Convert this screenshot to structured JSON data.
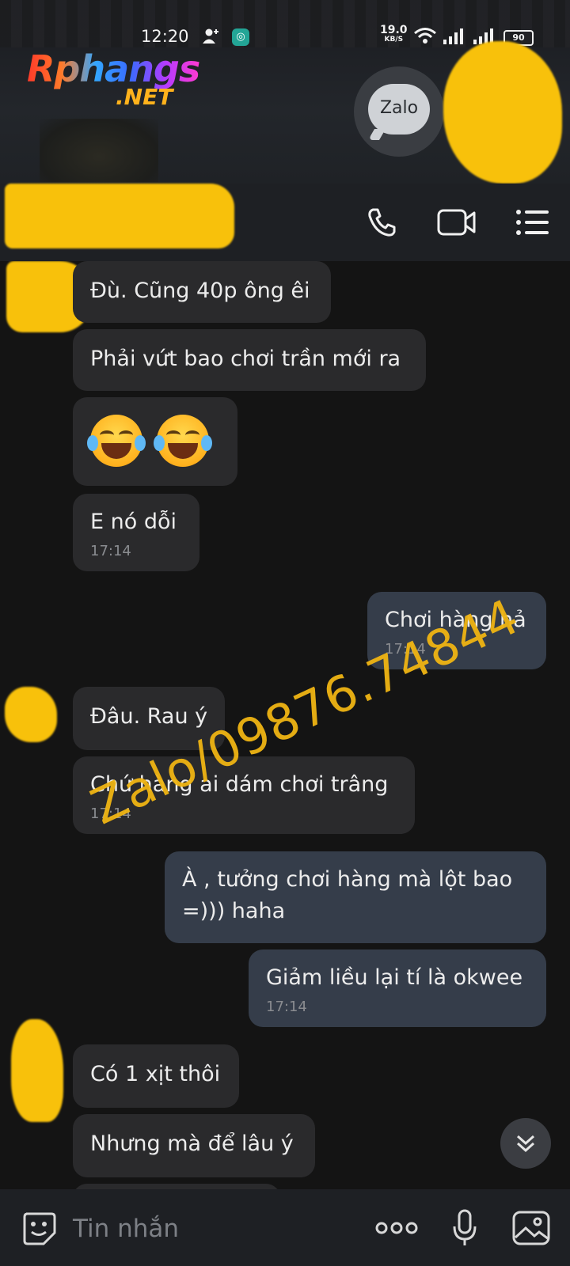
{
  "status_bar": {
    "time": "12:20",
    "speed_value": "19.0",
    "speed_unit": "KB/S",
    "battery": "90"
  },
  "logo": {
    "brand": "Rphangs",
    "suffix": ".NET"
  },
  "app_badge": "Zalo",
  "chat_header": {
    "icons": [
      "phone-icon",
      "video-call-icon",
      "menu-icon"
    ]
  },
  "messages": [
    {
      "side": "in",
      "text": "Đù. Cũng 40p ông êi",
      "time": ""
    },
    {
      "side": "in",
      "text": "Phải vứt bao chơi trần mới ra",
      "time": ""
    },
    {
      "side": "in",
      "text": "",
      "time": "",
      "emoji": "face-with-tears-of-joy x2"
    },
    {
      "side": "in",
      "text": "E nó dỗi",
      "time": "17:14"
    },
    {
      "side": "out",
      "text": "Chơi hàng hả",
      "time": "17:14"
    },
    {
      "side": "in",
      "text": "Đâu. Rau ý",
      "time": ""
    },
    {
      "side": "in",
      "text": "Chứ hàng ai dám chơi trâng",
      "time": "17:14"
    },
    {
      "side": "out",
      "text_line1": "À , tưởng chơi hàng mà lột bao",
      "text_line2": "=))) haha",
      "time": ""
    },
    {
      "side": "out",
      "text": "Giảm liều lại tí là okwee",
      "time": "17:14"
    },
    {
      "side": "in",
      "text": "Có 1 xịt thôi",
      "time": ""
    },
    {
      "side": "in",
      "text": "Nhưng mà để lâu ý",
      "time": ""
    }
  ],
  "watermark": "Zalo/09876.74844",
  "input": {
    "placeholder": "Tin nhắn"
  },
  "colors": {
    "background": "#141414",
    "incoming_bubble": "#2a2a2c",
    "outgoing_bubble": "#353d4a",
    "watermark": "#f0b513"
  }
}
